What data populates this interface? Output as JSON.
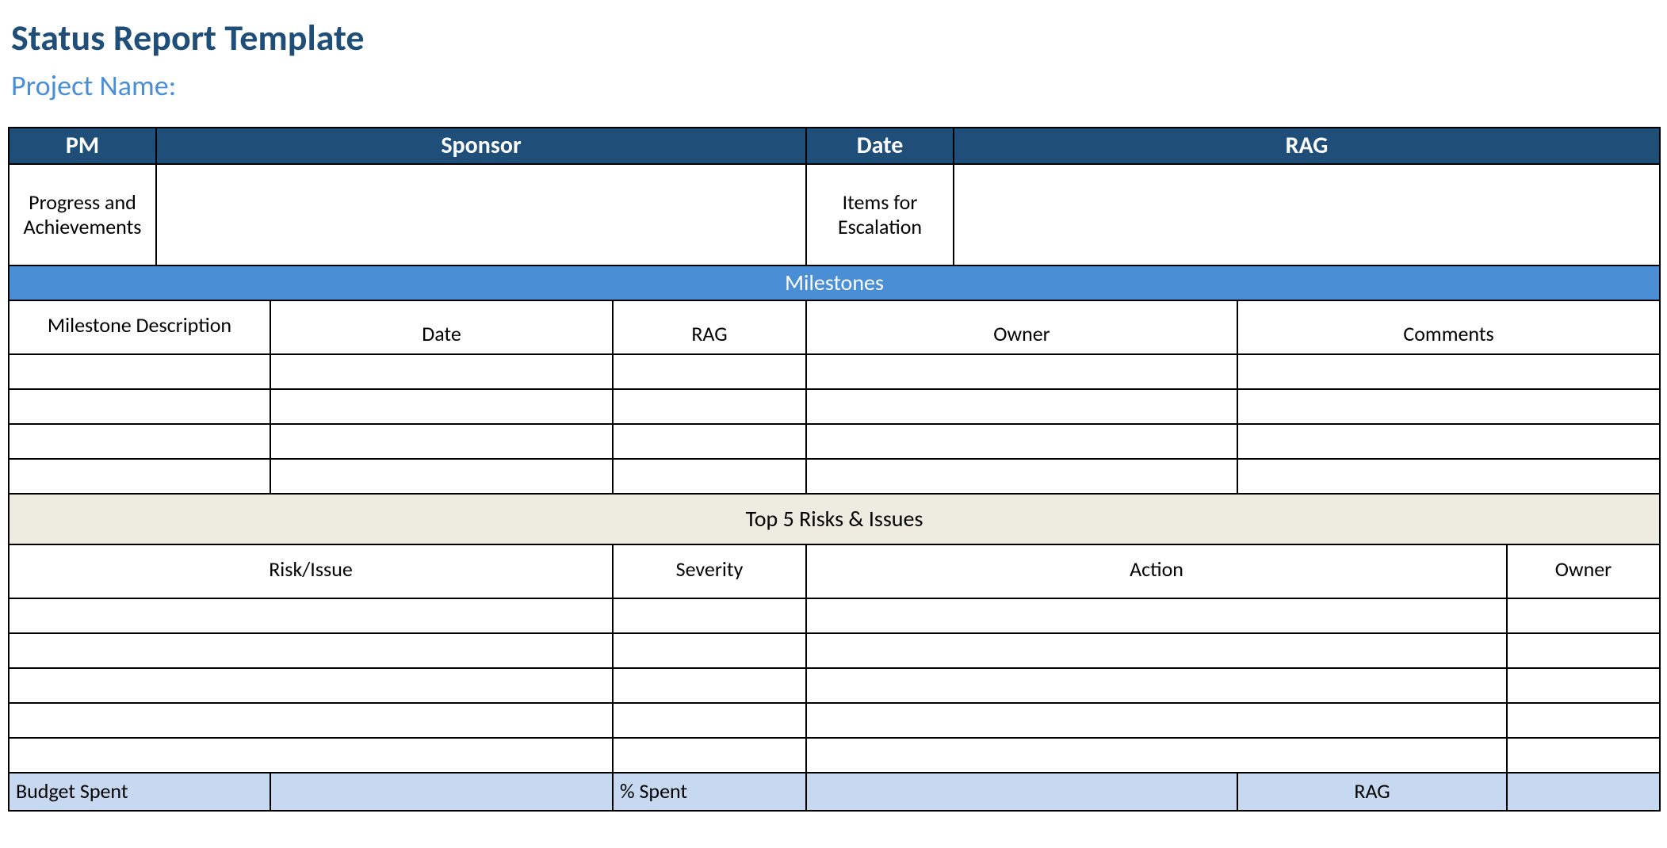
{
  "title": "Status Report Template",
  "subtitle": "Project Name:",
  "top_headers": {
    "pm": "PM",
    "sponsor": "Sponsor",
    "date": "Date",
    "rag": "RAG"
  },
  "row_labels": {
    "progress": "Progress and Achievements",
    "escalation": "Items for Escalation"
  },
  "sections": {
    "milestones_title": "Milestones",
    "milestones_cols": {
      "desc": "Milestone Description",
      "date": "Date",
      "rag": "RAG",
      "owner": "Owner",
      "comments": "Comments"
    },
    "risks_title": "Top 5 Risks & Issues",
    "risks_cols": {
      "risk": "Risk/Issue",
      "severity": "Severity",
      "action": "Action",
      "owner": "Owner"
    }
  },
  "budget": {
    "spent_label": "Budget Spent",
    "pct_label": "% Spent",
    "rag_label": "RAG"
  }
}
